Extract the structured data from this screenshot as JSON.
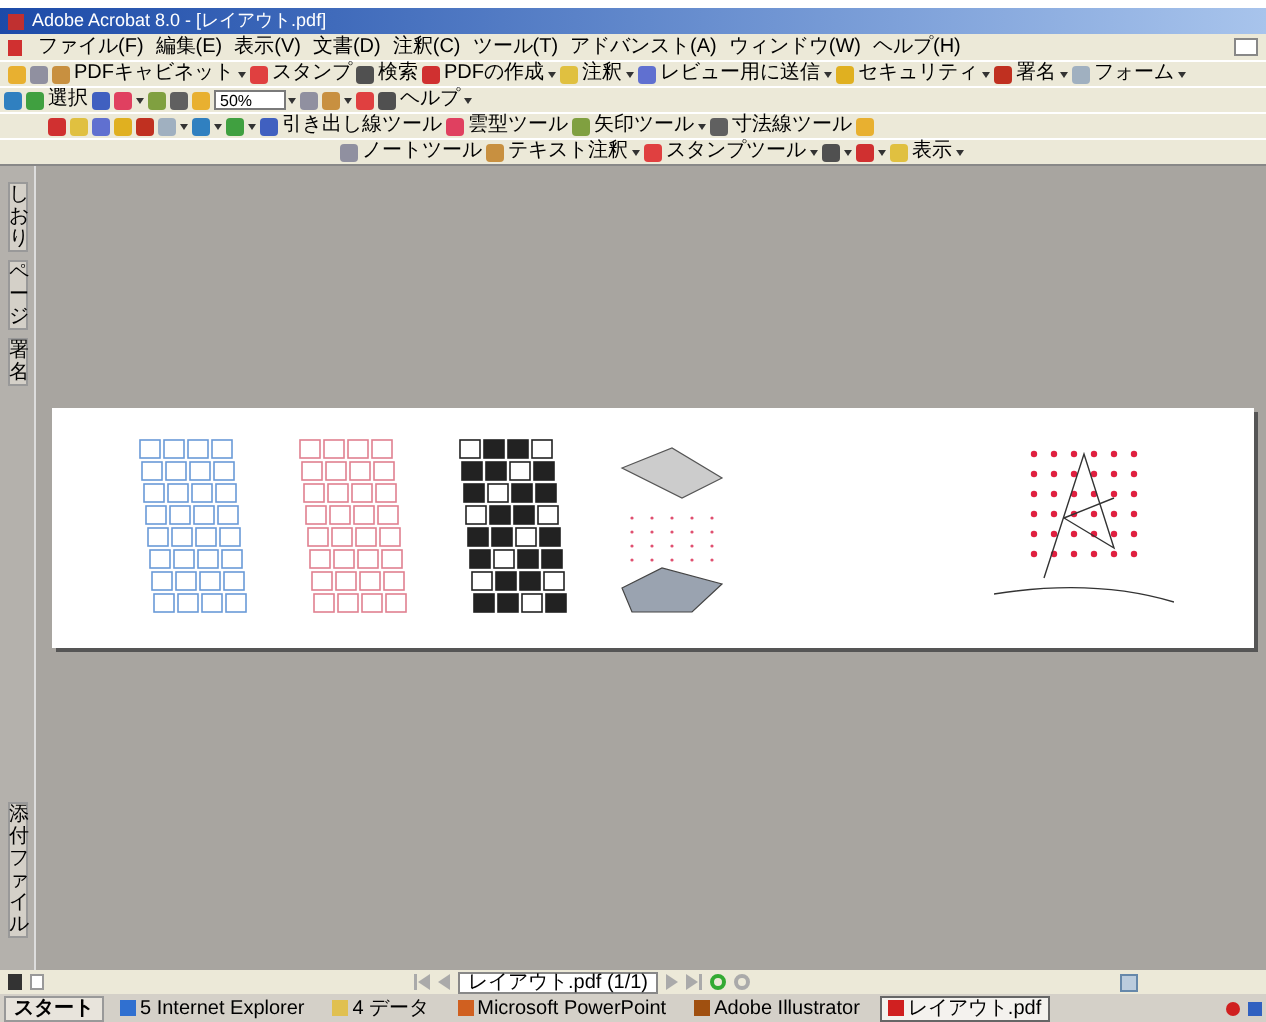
{
  "window": {
    "title": "Adobe Acrobat 8.0 - [レイアウト.pdf]"
  },
  "menu": [
    "ファイル(F)",
    "編集(E)",
    "表示(V)",
    "文書(D)",
    "注釈(C)",
    "ツール(T)",
    "アドバンスト(A)",
    "ウィンドウ(W)",
    "ヘルプ(H)"
  ],
  "toolbars": [
    [
      {
        "kind": "icon",
        "dropdown": false
      },
      {
        "kind": "icon",
        "dropdown": false
      },
      {
        "kind": "button",
        "label": "PDFキャビネット",
        "dropdown": true
      },
      {
        "kind": "button",
        "label": "スタンプ",
        "dropdown": false
      },
      {
        "kind": "button",
        "label": "検索",
        "dropdown": false
      },
      {
        "kind": "button",
        "label": "PDFの作成",
        "dropdown": true
      },
      {
        "kind": "button",
        "label": "注釈",
        "dropdown": true
      },
      {
        "kind": "button",
        "label": "レビュー用に送信",
        "dropdown": true
      },
      {
        "kind": "button",
        "label": "セキュリティ",
        "dropdown": true
      },
      {
        "kind": "button",
        "label": "署名",
        "dropdown": true
      },
      {
        "kind": "button",
        "label": "フォーム",
        "dropdown": true
      }
    ],
    [
      {
        "kind": "icon",
        "dropdown": false
      },
      {
        "kind": "button",
        "label": "選択",
        "dropdown": false
      },
      {
        "kind": "icon",
        "dropdown": false
      },
      {
        "kind": "icon",
        "dropdown": true
      },
      {
        "kind": "icon",
        "dropdown": false
      },
      {
        "kind": "icon",
        "dropdown": false
      },
      {
        "kind": "icon",
        "dropdown": false
      },
      {
        "kind": "zoom",
        "label": "50%",
        "dropdown": true
      },
      {
        "kind": "icon",
        "dropdown": false
      },
      {
        "kind": "icon",
        "dropdown": true
      },
      {
        "kind": "icon",
        "dropdown": false
      },
      {
        "kind": "button",
        "label": "ヘルプ",
        "dropdown": true
      }
    ],
    [
      {
        "kind": "icon",
        "dropdown": false
      },
      {
        "kind": "icon",
        "dropdown": false
      },
      {
        "kind": "icon",
        "dropdown": false
      },
      {
        "kind": "icon",
        "dropdown": false
      },
      {
        "kind": "icon",
        "dropdown": false
      },
      {
        "kind": "icon",
        "dropdown": true
      },
      {
        "kind": "icon",
        "dropdown": true
      },
      {
        "kind": "icon",
        "dropdown": true
      },
      {
        "kind": "button",
        "label": "引き出し線ツール",
        "dropdown": false
      },
      {
        "kind": "button",
        "label": "雲型ツール",
        "dropdown": false
      },
      {
        "kind": "button",
        "label": "矢印ツール",
        "dropdown": true
      },
      {
        "kind": "button",
        "label": "寸法線ツール",
        "dropdown": false
      },
      {
        "kind": "icon",
        "dropdown": false
      }
    ],
    [
      {
        "kind": "button",
        "label": "ノートツール",
        "dropdown": false
      },
      {
        "kind": "button",
        "label": "テキスト注釈",
        "dropdown": true
      },
      {
        "kind": "button",
        "label": "スタンプツール",
        "dropdown": true
      },
      {
        "kind": "icon",
        "dropdown": true
      },
      {
        "kind": "icon",
        "dropdown": true
      },
      {
        "kind": "button",
        "label": "表示",
        "dropdown": true
      }
    ]
  ],
  "side_tabs_top": [
    "しおり",
    "ページ",
    "署名"
  ],
  "side_tabs_bottom": [
    "添付ファイル"
  ],
  "status_bar": {
    "page_field": "レイアウト.pdf (1/1)"
  },
  "taskbar": {
    "start": "スタート",
    "items": [
      {
        "label": "5 Internet Explorer",
        "color": "#3070d0",
        "selected": false
      },
      {
        "label": "4 データ",
        "color": "#e0c050",
        "selected": false
      },
      {
        "label": "Microsoft PowerPoint",
        "color": "#d06020",
        "selected": false
      },
      {
        "label": "Adobe Illustrator",
        "color": "#a05010",
        "selected": false
      },
      {
        "label": "レイアウト.pdf",
        "color": "#d02020",
        "selected": true
      }
    ]
  }
}
